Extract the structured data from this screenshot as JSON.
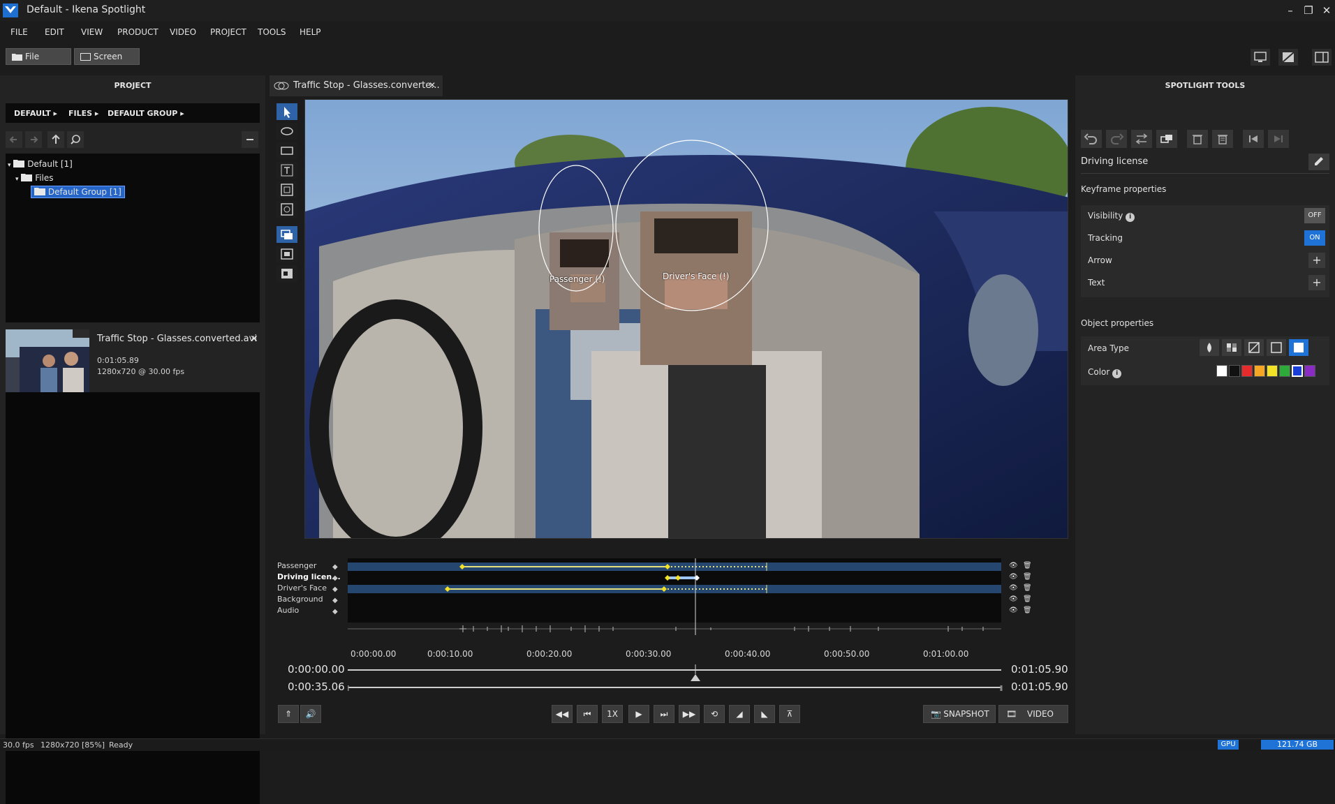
{
  "window": {
    "title": "Default - Ikena Spotlight",
    "minimize": "–",
    "maximize": "❐",
    "close": "✕"
  },
  "menu": [
    "FILE",
    "EDIT",
    "VIEW",
    "PRODUCT",
    "VIDEO",
    "PROJECT",
    "TOOLS",
    "HELP"
  ],
  "toolbar": {
    "file_label": "File",
    "screen_label": "Screen"
  },
  "project": {
    "title": "PROJECT",
    "breadcrumbs": [
      "DEFAULT",
      "FILES",
      "DEFAULT GROUP"
    ],
    "tree": [
      {
        "label": "Default [1]"
      },
      {
        "label": "Files"
      },
      {
        "label": "Default Group [1]"
      }
    ],
    "file": {
      "name": "Traffic Stop - Glasses.converted.avi",
      "duration": "0:01:05.89",
      "format": "1280x720 @ 30.00 fps"
    }
  },
  "viewer": {
    "tab_title": "Traffic Stop - Glasses.converte...",
    "overlays": [
      {
        "label": "Passenger (!)"
      },
      {
        "label": "Driver's Face (!)"
      }
    ]
  },
  "timeline": {
    "tracks": [
      {
        "name": "Passenger"
      },
      {
        "name": "Driving licen..."
      },
      {
        "name": "Driver's Face"
      },
      {
        "name": "Background"
      },
      {
        "name": "Audio"
      }
    ],
    "ticks": [
      "0:00:00.00",
      "0:00:10.00",
      "0:00:20.00",
      "0:00:30.00",
      "0:00:40.00",
      "0:00:50.00",
      "0:01:00.00"
    ],
    "start_time": "0:00:00.00",
    "current_time": "0:00:35.06",
    "end_time_1": "0:01:05.90",
    "end_time_2": "0:01:05.90",
    "playhead_fraction": 0.532
  },
  "transport": {
    "speed": "1X",
    "snapshot_label": "SNAPSHOT",
    "video_label": "VIDEO"
  },
  "spotlight": {
    "title": "SPOTLIGHT TOOLS",
    "object_name": "Driving license",
    "keyframe_props_title": "Keyframe properties",
    "visibility_label": "Visibility",
    "visibility_value": "OFF",
    "tracking_label": "Tracking",
    "tracking_value": "ON",
    "arrow_label": "Arrow",
    "text_label": "Text",
    "object_props_title": "Object properties",
    "area_type_label": "Area Type",
    "color_label": "Color",
    "colors": [
      "#ffffff",
      "#111111",
      "#e52b2b",
      "#f5a623",
      "#f2e227",
      "#2eaa3a",
      "#1a3fd6",
      "#8a2bc4"
    ],
    "selected_color": "#1a3fd6"
  },
  "status": {
    "fps": "30.0 fps",
    "resolution": "1280x720 [85%]",
    "state": "Ready",
    "gpu": "GPU",
    "disk": "121.74 GB"
  }
}
